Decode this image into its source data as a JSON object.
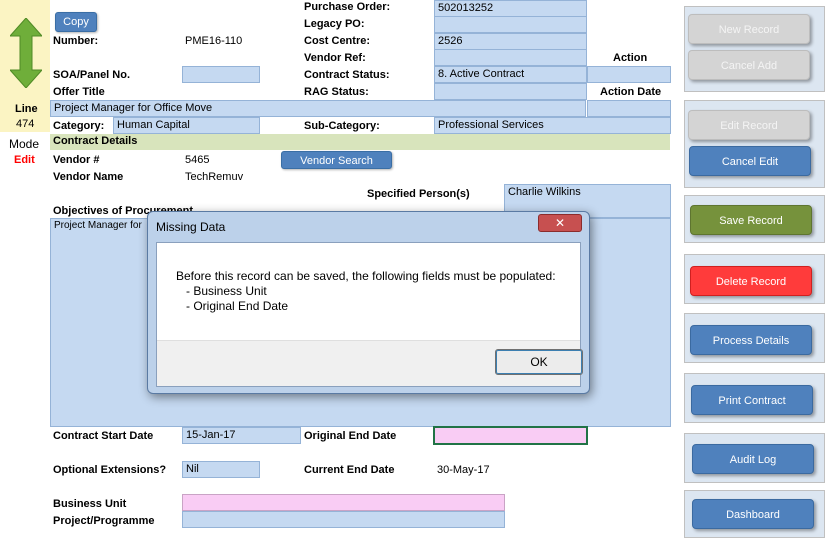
{
  "left": {
    "line_label": "Line",
    "line_number": "474",
    "mode_label": "Mode",
    "mode_value": "Edit",
    "colors": {
      "mode_value": "#ff0000",
      "arrow": "#6fae3a"
    },
    "arrow_icon": "up-down-arrow-icon"
  },
  "form": {
    "copy_button": "Copy",
    "number_label": "Number:",
    "number_value": "PME16-110",
    "soa_label": "SOA/Panel No.",
    "offer_title_label": "Offer Title",
    "offer_title_value": "Project Manager for Office Move",
    "category_label": "Category:",
    "category_value": "Human Capital",
    "subcategory_label": "Sub-Category:",
    "subcategory_value": "Professional Services",
    "purchase_order_label": "Purchase Order:",
    "purchase_order_value": "502013252",
    "legacy_po_label": "Legacy PO:",
    "cost_centre_label": "Cost Centre:",
    "cost_centre_value": "2526",
    "vendor_ref_label": "Vendor Ref:",
    "contract_status_label": "Contract Status:",
    "contract_status_value": "8. Active Contract",
    "rag_status_label": "RAG Status:",
    "action_label": "Action",
    "action_date_label": "Action Date",
    "contract_details_header": "Contract Details",
    "vendor_num_label": "Vendor #",
    "vendor_num_value": "5465",
    "vendor_search_button": "Vendor Search",
    "vendor_name_label": "Vendor Name",
    "vendor_name_value": "TechRemuv",
    "specified_person_label": "Specified Person(s)",
    "specified_person_value": "Charlie Wilkins",
    "objectives_label": "Objectives of Procurement",
    "objectives_value": "Project Manager for",
    "contract_start_label": "Contract Start Date",
    "contract_start_value": "15-Jan-17",
    "original_end_label": "Original End Date",
    "optional_ext_label": "Optional Extensions?",
    "optional_ext_value": "Nil",
    "current_end_label": "Current End Date",
    "current_end_value": "30-May-17",
    "business_unit_label": "Business Unit",
    "project_programme_label": "Project/Programme"
  },
  "actions": {
    "new_record": "New Record",
    "cancel_add": "Cancel Add",
    "edit_record": "Edit Record",
    "cancel_edit": "Cancel Edit",
    "save_record": "Save Record",
    "delete_record": "Delete Record",
    "process_details": "Process Details",
    "print_contract": "Print Contract",
    "audit_log": "Audit Log",
    "dashboard": "Dashboard"
  },
  "dialog": {
    "title": "Missing Data",
    "close_icon": "close-icon",
    "message_line1": "Before this record can be saved, the following fields must be populated:",
    "message_line2": "   - Business Unit",
    "message_line3": "   - Original End Date",
    "ok_button": "OK"
  },
  "colors": {
    "field_blue": "#c5d9f1",
    "field_pink": "#f9ccf4",
    "section_green": "#d8e4bc",
    "button_blue": "#4f81bd",
    "button_green": "#76923c",
    "button_red": "#ff3b3b",
    "button_disabled": "#d4d4d4"
  }
}
